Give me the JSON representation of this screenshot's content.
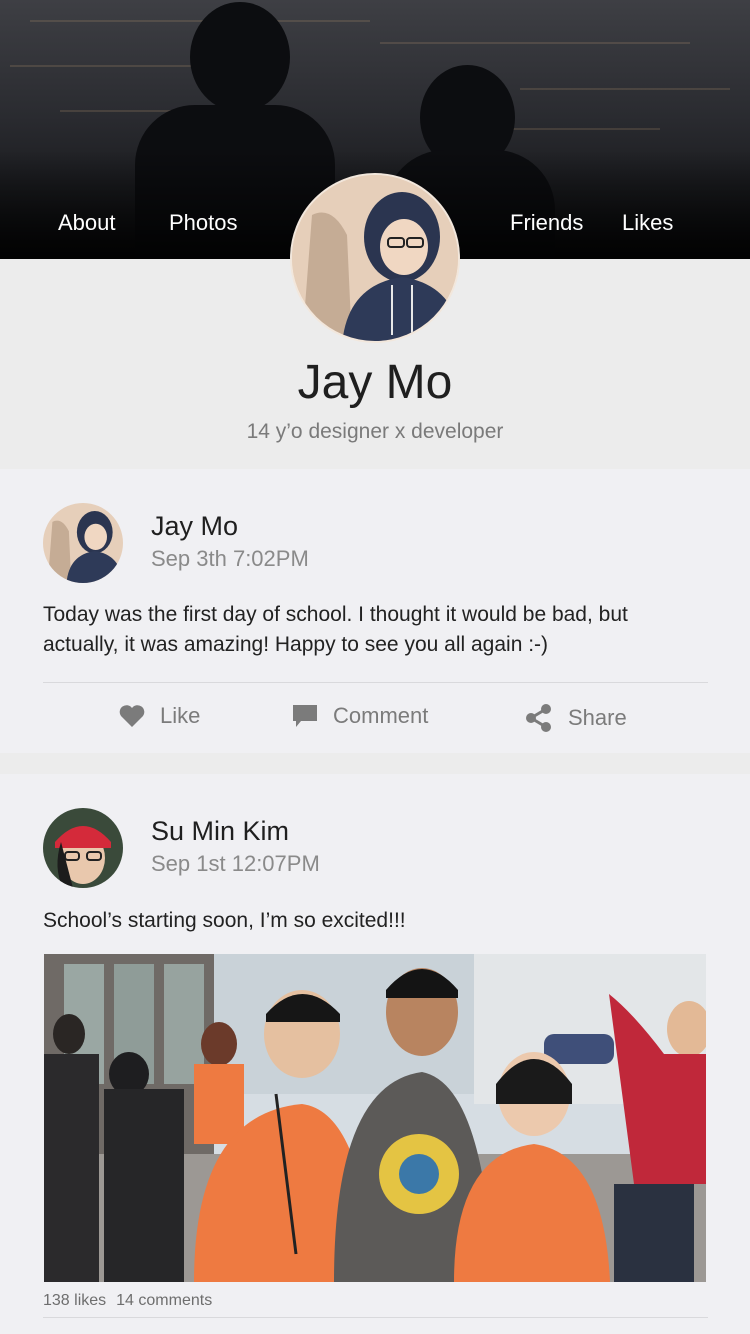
{
  "nav": {
    "about": "About",
    "photos": "Photos",
    "friends": "Friends",
    "likes": "Likes"
  },
  "profile": {
    "name": "Jay Mo",
    "bio": "14 y’o designer x developer"
  },
  "posts": [
    {
      "author": "Jay Mo",
      "time": "Sep 3th 7:02PM",
      "text": "Today was the first day of school. I thought it would be bad, but actually, it was amazing! Happy to see you all again :-)",
      "actions": {
        "like": "Like",
        "comment": "Comment",
        "share": "Share"
      }
    },
    {
      "author": "Su Min Kim",
      "time": "Sep 1st 12:07PM",
      "text": "School’s starting soon, I’m so excited!!!",
      "likes": "138 likes",
      "comments": "14 comments"
    }
  ],
  "icons": {
    "like": "heart-icon",
    "comment": "speech-bubble-icon",
    "share": "share-nodes-icon"
  },
  "colors": {
    "background": "#ececec",
    "card": "#f0f0f3",
    "text": "#1f1f1f",
    "muted": "#8a8a8a",
    "icon": "#7b7b7b",
    "shirt": "#ee7a41"
  }
}
